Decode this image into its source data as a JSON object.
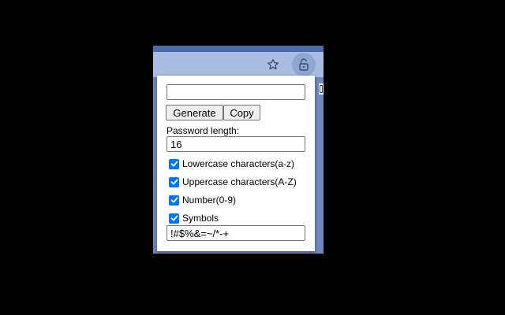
{
  "toolbar": {
    "bookmark_icon": "star-icon",
    "extension_icon": "unlock-icon"
  },
  "popup": {
    "password_output": {
      "value": "",
      "placeholder": ""
    },
    "buttons": {
      "generate": "Generate",
      "copy": "Copy"
    },
    "length": {
      "label": "Password length:",
      "value": "16"
    },
    "options": [
      {
        "label": "Lowercase characters(a-z)",
        "checked": true
      },
      {
        "label": "Uppercase characters(A-Z)",
        "checked": true
      },
      {
        "label": "Number(0-9)",
        "checked": true
      },
      {
        "label": "Symbols",
        "checked": true
      }
    ],
    "symbols_value": "!#$%&=~/*-+"
  },
  "colors": {
    "background": "#000000",
    "browser_toolbar": "#a9bde3",
    "browser_frame": "#6e87bd",
    "checkbox_accent": "#0075ff"
  }
}
